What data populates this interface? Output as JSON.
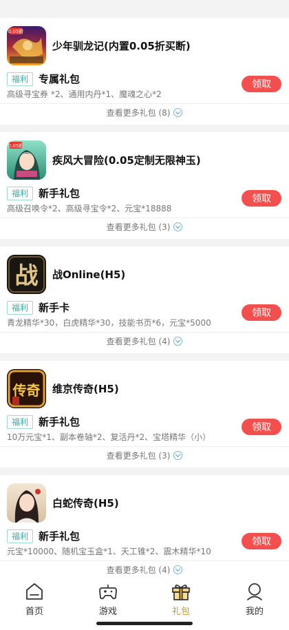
{
  "games": [
    {
      "title": "少年驯龙记(内置0.05折买断)",
      "icon": "dragon-game-icon",
      "icon_text": "0.05折",
      "tag": "福利",
      "gift_name": "专属礼包",
      "gift_desc": "高级寻宝券 *2、通用内丹*1、魔魂之心*2",
      "claim_label": "领取",
      "more_label": "查看更多礼包 (8)"
    },
    {
      "title": "疾风大冒险(0.05定制无限神玉)",
      "icon": "anime-girl-game-icon",
      "icon_text": "0.05折",
      "tag": "福利",
      "gift_name": "新手礼包",
      "gift_desc": "高级召唤令*2、高级寻宝令*2、元宝*18888",
      "claim_label": "领取",
      "more_label": "查看更多礼包 (3)"
    },
    {
      "title": "战Online(H5)",
      "icon": "zhan-calligraphy-icon",
      "icon_text": "战",
      "tag": "福利",
      "gift_name": "新手卡",
      "gift_desc": "青龙精华*30，白虎精华*30，技能书页*6，元宝*5000",
      "claim_label": "领取",
      "more_label": "查看更多礼包 (4)"
    },
    {
      "title": "维京传奇(H5)",
      "icon": "chuanqi-calligraphy-icon",
      "icon_text": "传奇",
      "tag": "福利",
      "gift_name": "新手礼包",
      "gift_desc": "10万元宝*1、副本卷轴*2、复活丹*2、宝塔精华（小）",
      "claim_label": "领取",
      "more_label": "查看更多礼包 (3)"
    },
    {
      "title": "白蛇传奇(H5)",
      "icon": "lady-portrait-icon",
      "icon_text": "",
      "tag": "福利",
      "gift_name": "新手礼包",
      "gift_desc": "元宝*10000、随机宝玉盒*1、天工锥*2、震木精华*10",
      "claim_label": "领取",
      "more_label": "查看更多礼包 (4)"
    }
  ],
  "tabbar": {
    "tabs": [
      {
        "label": "首页",
        "icon": "home-icon",
        "active": false
      },
      {
        "label": "游戏",
        "icon": "gamepad-icon",
        "active": false
      },
      {
        "label": "礼包",
        "icon": "gift-icon",
        "active": true
      },
      {
        "label": "我的",
        "icon": "user-icon",
        "active": false
      }
    ]
  },
  "colors": {
    "claim_button": "#f24f4f",
    "tag_text": "#3aaea5",
    "active_tab": "#c39a2f",
    "chevron": "#3d9de0"
  }
}
